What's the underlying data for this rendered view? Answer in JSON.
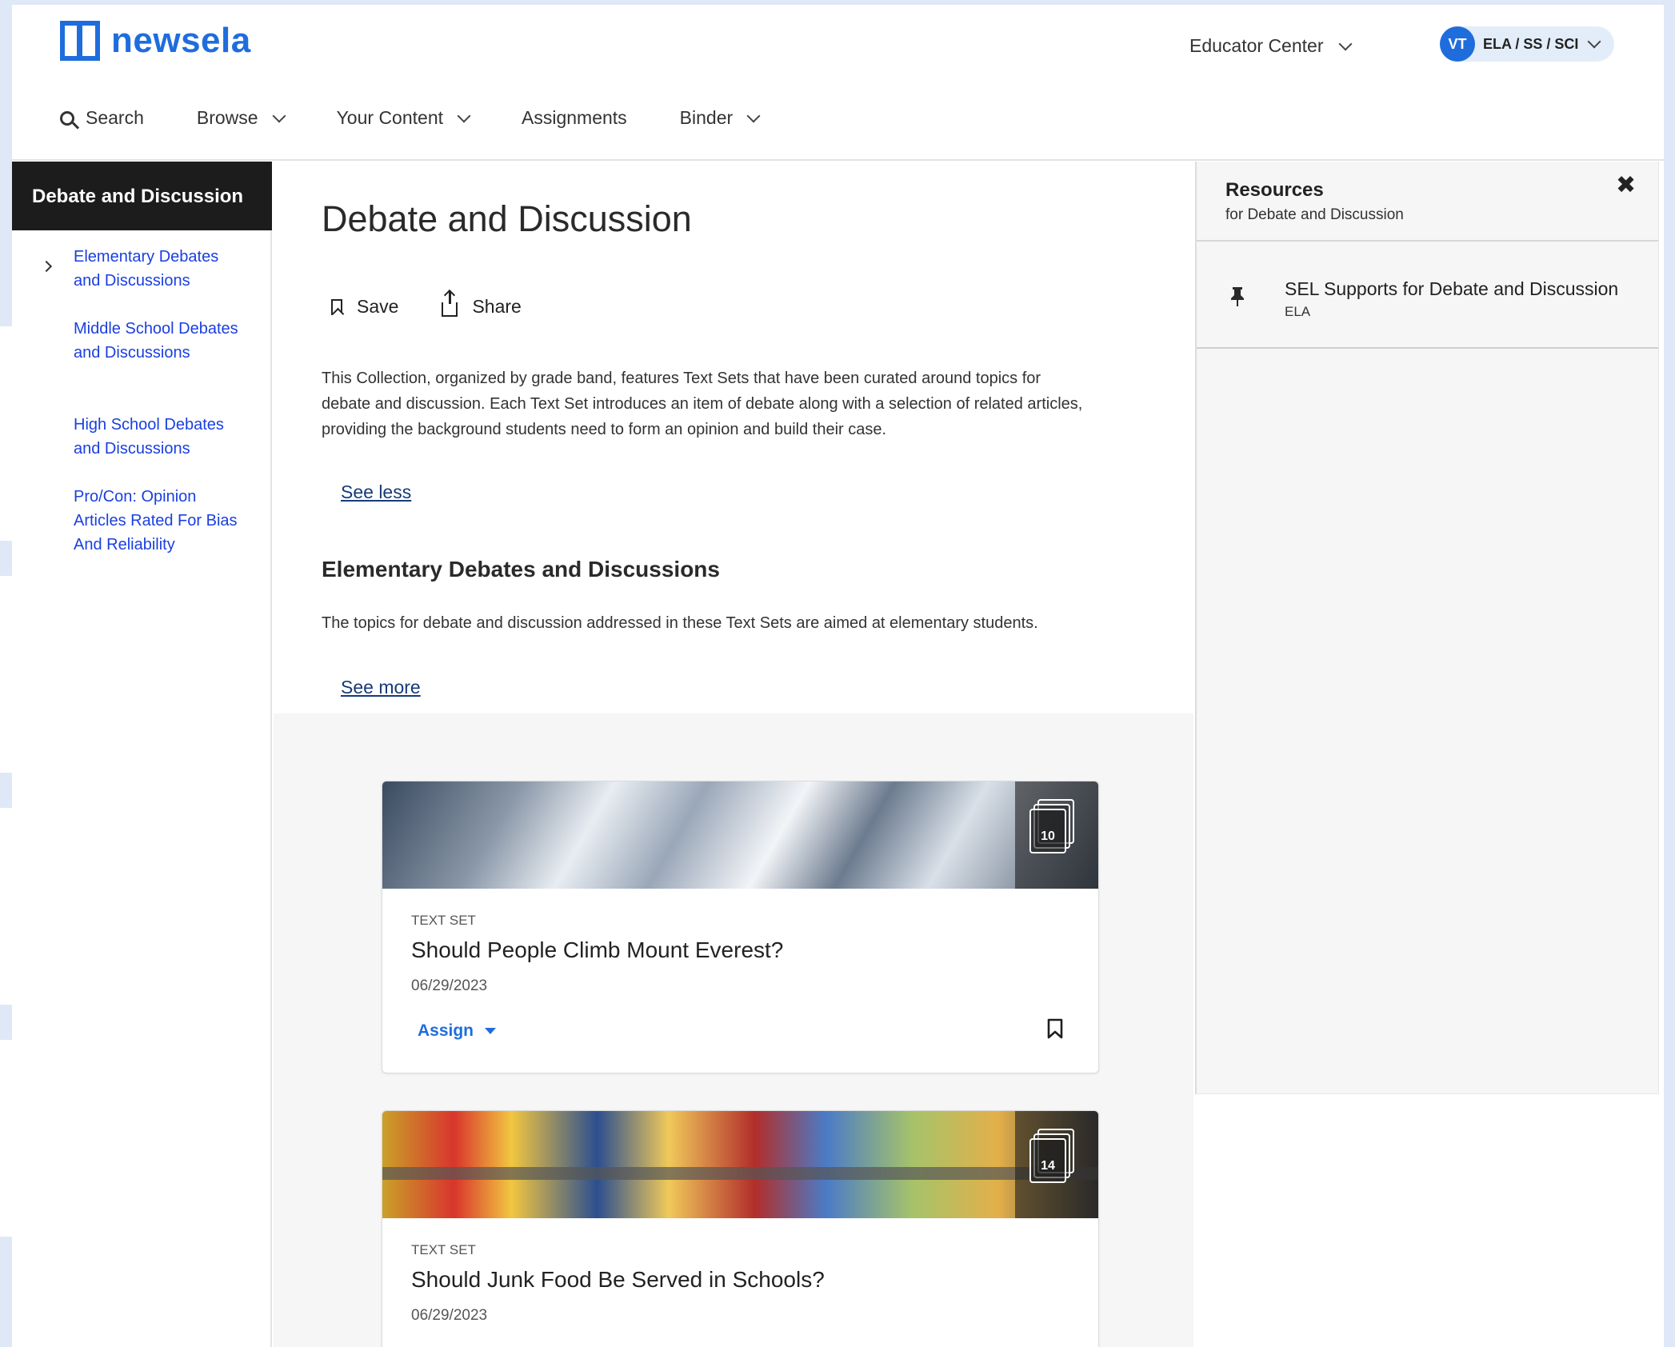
{
  "brand": {
    "name": "newsela"
  },
  "header": {
    "educator_center": "Educator Center",
    "user_initials": "VT",
    "user_subjects": "ELA / SS / SCI"
  },
  "nav": {
    "search": "Search",
    "browse": "Browse",
    "your_content": "Your Content",
    "assignments": "Assignments",
    "binder": "Binder"
  },
  "sidebar": {
    "heading": "Debate and Discussion",
    "items": [
      {
        "label": "Elementary Debates and Discussions"
      },
      {
        "label": "Middle School Debates and Discussions"
      },
      {
        "label": "High School Debates and Discussions"
      },
      {
        "label": "Pro/Con: Opinion Articles Rated For Bias And Reliability"
      }
    ]
  },
  "main": {
    "title": "Debate and Discussion",
    "save_label": "Save",
    "share_label": "Share",
    "description": "This Collection, organized by grade band, features Text Sets that have been curated around topics for debate and discussion. Each Text Set introduces an item of debate along with a selection of related articles, providing the background students need to form an opinion and build their case.",
    "see_less": "See less",
    "section": {
      "heading": "Elementary Debates and Discussions",
      "description": "The topics for debate and discussion addressed in these Text Sets are aimed at elementary students.",
      "see_more": "See more"
    },
    "cards": [
      {
        "type": "TEXT SET",
        "title": "Should People Climb Mount Everest?",
        "date": "06/29/2023",
        "count": "10",
        "assign": "Assign"
      },
      {
        "type": "TEXT SET",
        "title": "Should Junk Food Be Served in Schools?",
        "date": "06/29/2023",
        "count": "14"
      }
    ]
  },
  "resources": {
    "title": "Resources",
    "subtitle": "for Debate and Discussion",
    "close": "✖",
    "items": [
      {
        "title": "SEL Supports for Debate and Discussion",
        "subject": "ELA"
      }
    ]
  },
  "colors": {
    "brand_blue": "#1f6ddd",
    "link_blue": "#1a3fe0",
    "sidebar_head": "#1c1c1c"
  }
}
